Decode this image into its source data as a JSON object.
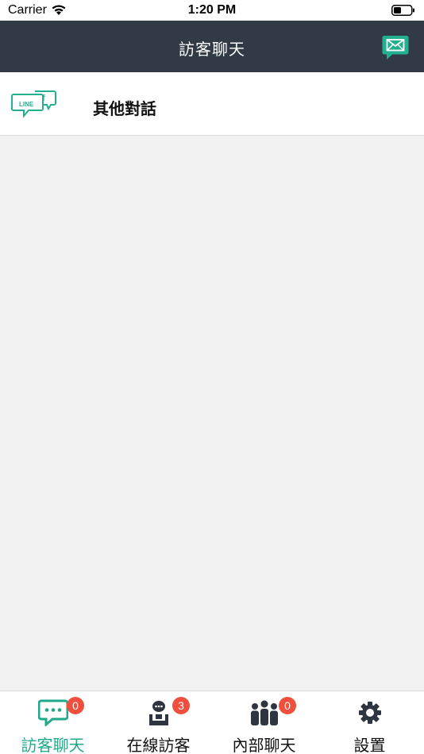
{
  "status_bar": {
    "carrier": "Carrier",
    "time": "1:20 PM"
  },
  "nav": {
    "title": "訪客聊天",
    "mail_icon": "mail-icon"
  },
  "list": {
    "items": [
      {
        "label": "其他對話",
        "icon": "line-facebook-chat-icon"
      }
    ]
  },
  "tabs": [
    {
      "label": "訪客聊天",
      "icon": "chat-bubble-icon",
      "badge": "0",
      "active": true
    },
    {
      "label": "在線訪客",
      "icon": "online-visitor-icon",
      "badge": "3",
      "active": false
    },
    {
      "label": "內部聊天",
      "icon": "group-icon",
      "badge": "0",
      "active": false
    },
    {
      "label": "設置",
      "icon": "gear-icon",
      "badge": "",
      "active": false
    }
  ],
  "colors": {
    "nav_bg": "#323a45",
    "accent": "#20a98a",
    "badge": "#ef4f3c",
    "content_bg": "#f2f2f2"
  }
}
